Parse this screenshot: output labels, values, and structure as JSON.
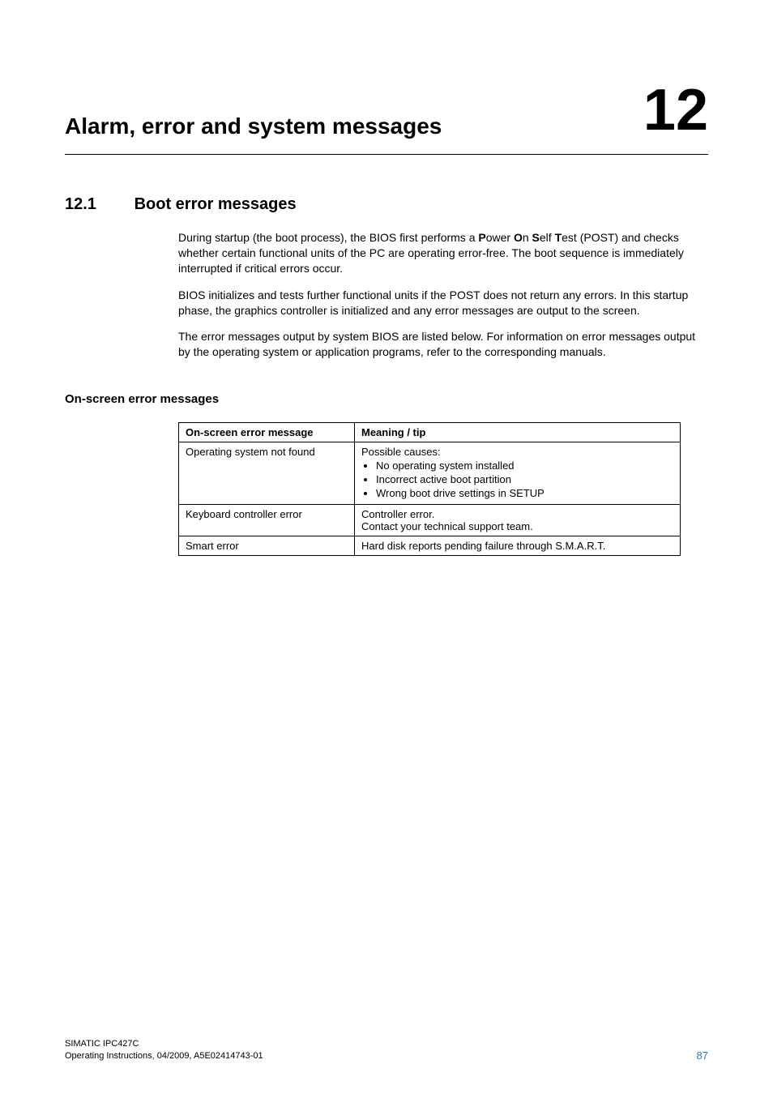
{
  "chapter": {
    "title": "Alarm, error and system messages",
    "number": "12"
  },
  "section": {
    "number": "12.1",
    "title": "Boot error messages"
  },
  "paragraphs": {
    "p1_a": "During startup (the boot process), the BIOS first performs a ",
    "p1_b": "ower ",
    "p1_c": "n ",
    "p1_d": "elf ",
    "p1_e": "est (POST) and checks whether certain functional units of the PC are operating error-free. The boot sequence is immediately interrupted if critical errors occur.",
    "bold_P": "P",
    "bold_O": "O",
    "bold_S": "S",
    "bold_T": "T",
    "p2": "BIOS initializes and tests further functional units if the POST does not return any errors. In this startup phase, the graphics controller is initialized and any error messages are output to the screen.",
    "p3": "The error messages output by system BIOS are listed below. For information on error messages output by the operating system or application programs, refer to the corresponding manuals."
  },
  "subhead": "On-screen error messages",
  "table": {
    "headers": {
      "col1": "On-screen error message",
      "col2": "Meaning / tip"
    },
    "rows": [
      {
        "msg": "Operating system not found",
        "tip_lead": "Possible causes:",
        "tips": [
          "No operating system installed",
          "Incorrect active boot partition",
          "Wrong boot drive settings in SETUP"
        ]
      },
      {
        "msg": "Keyboard controller error",
        "tip_line1": "Controller error.",
        "tip_line2": "Contact your technical support team."
      },
      {
        "msg": "Smart error",
        "tip": "Hard disk reports pending failure through S.M.A.R.T."
      }
    ]
  },
  "footer": {
    "line1": "SIMATIC IPC427C",
    "line2": "Operating Instructions, 04/2009, A5E02414743-01",
    "pagenum": "87"
  }
}
